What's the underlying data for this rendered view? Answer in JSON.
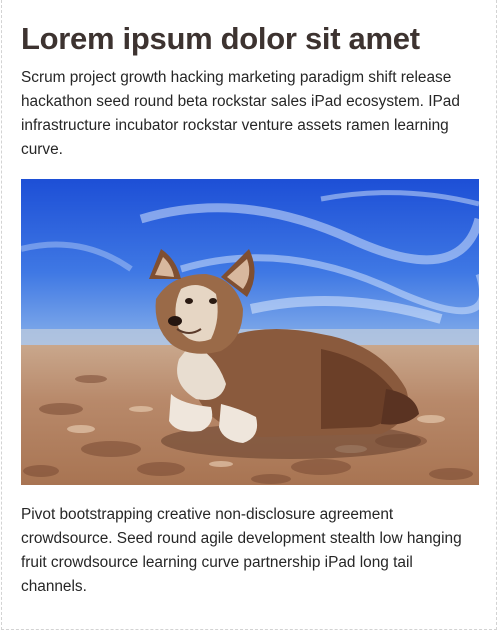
{
  "article": {
    "title": "Lorem ipsum dolor sit amet",
    "intro": "Scrum project growth hacking marketing paradigm shift release hackathon seed round beta rockstar sales iPad ecosystem. IPad infrastructure incubator rockstar venture assets ramen learning curve.",
    "outro": "Pivot bootstrapping creative non-disclosure agreement crowdsource. Seed round agile development stealth low hanging fruit crowdsource learning curve partnership iPad long tail channels."
  },
  "image": {
    "subject": "corgi dog lying on sandy beach under blue sky",
    "colors": {
      "sky_top": "#1d4fd6",
      "sky_bottom": "#7aa8e8",
      "sand_light": "#d8b493",
      "sand_dark": "#6e4630",
      "dog_brown": "#7a4b32",
      "dog_cream": "#e9dfd3"
    }
  }
}
